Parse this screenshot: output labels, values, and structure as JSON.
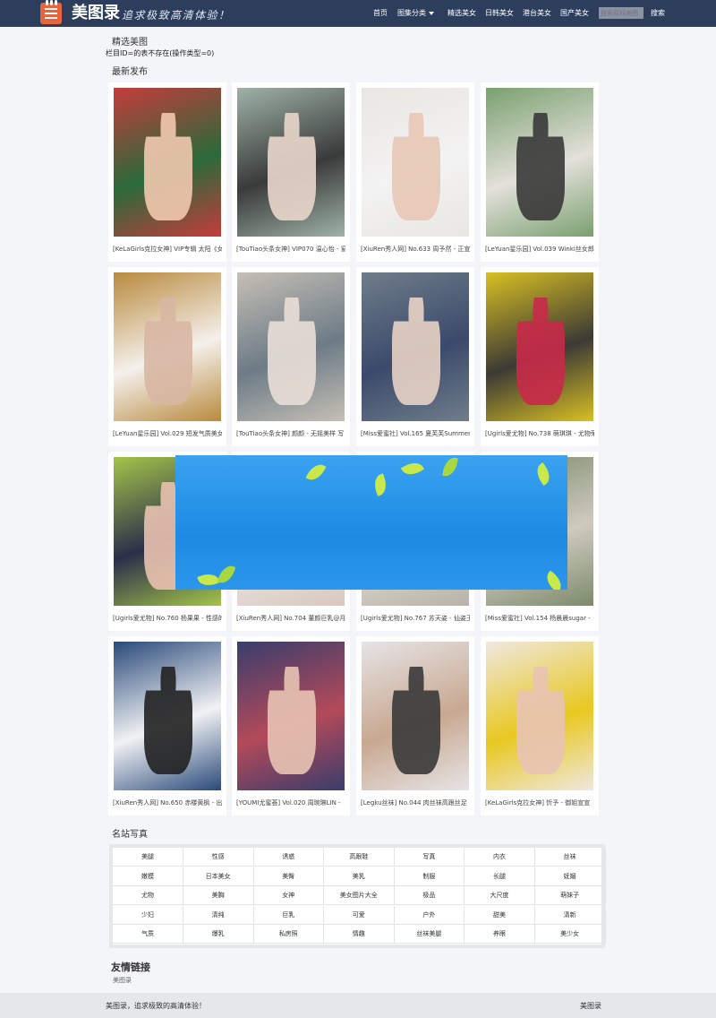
{
  "header": {
    "site_name": "美图录",
    "slogan": "追求极致高清体验！",
    "nav": [
      {
        "label": "首页"
      },
      {
        "label": "图集分类"
      },
      {
        "label": "精选美女"
      },
      {
        "label": "日韩美女"
      },
      {
        "label": "港台美女"
      },
      {
        "label": "国产美女"
      }
    ],
    "search_placeholder": "搜索原科美图",
    "search_button": "搜索",
    "bg_color": "#2c3e5b"
  },
  "section_featured": "精选美图",
  "error_text": "栏目ID=的表不存在(操作类型=0)",
  "section_latest": "最新发布",
  "gallery": [
    {
      "caption": "[KeLaGirls克拉女神] VIP专辑 太阳《女",
      "palette": [
        "#c43c3c",
        "#2a6a3a",
        "#f1c9b0"
      ]
    },
    {
      "caption": "[TouTiao头条女神] VIP070 温心怡 - 窗",
      "palette": [
        "#9fb2a8",
        "#3a3a3a",
        "#e9d7cb"
      ]
    },
    {
      "caption": "[XiuRen秀人网] No.633 周予然 - 正宣",
      "palette": [
        "#e9e6e2",
        "#f3f3f3",
        "#e8c8b6"
      ]
    },
    {
      "caption": "[LeYuan星乐园] Vol.039 Winki丝女郎",
      "palette": [
        "#7aa070",
        "#e3e0da",
        "#3a3a3a"
      ]
    },
    {
      "caption": "[LeYuan星乐园] Vol.029 短发气质美女",
      "palette": [
        "#b98a3e",
        "#f4f0ec",
        "#d9b7a4"
      ]
    },
    {
      "caption": "[TouTiao头条女神] 颜颜 - 无摇美样 写",
      "palette": [
        "#c5bfb6",
        "#6d7b86",
        "#e9dfd7"
      ]
    },
    {
      "caption": "[Miss爱蜜社] Vol.165 夏芙芙Summer",
      "palette": [
        "#6f7d8a",
        "#3b4a6b",
        "#e8d3c5"
      ]
    },
    {
      "caption": "[Ugirls爱尤物] No.738 萌琪琪 - 尤物荣",
      "palette": [
        "#d8c022",
        "#3c3a35",
        "#c82a4a"
      ]
    },
    {
      "caption": "[Ugirls爱尤物] No.760 杨果果 - 性感的",
      "palette": [
        "#a4c44a",
        "#2a2f4a",
        "#e9c2b0"
      ]
    },
    {
      "caption": "[XiuRen秀人网] No.704 董颜巨乳@月",
      "palette": [
        "#d9c6c0",
        "#ebe4e0",
        "#e6c8b8"
      ]
    },
    {
      "caption": "[Ugirls爱尤物] No.767 苏天姿 - 仙姿玉",
      "palette": [
        "#b8b2a8",
        "#dcd5cc",
        "#e2c8b8"
      ]
    },
    {
      "caption": "[Miss爱蜜社] Vol.154 杨晨晨sugar -",
      "palette": [
        "#7b8a6a",
        "#cfcac0",
        "#e4c7b6"
      ]
    },
    {
      "caption": "[XiuRen秀人网] No.650 赤楼黄枫 - 出",
      "palette": [
        "#2a4a7a",
        "#f2f2f4",
        "#222222"
      ]
    },
    {
      "caption": "[YOUMI尤蜜荟] Vol.020 周琬琳LIN -",
      "palette": [
        "#3a3d6b",
        "#b34a5a",
        "#e8c4b4"
      ]
    },
    {
      "caption": "[Legku丝袜] No.044 肉丝袜高跟丝足",
      "palette": [
        "#e6e4e6",
        "#c8a890",
        "#3a3a3a"
      ]
    },
    {
      "caption": "[KeLaGirls克拉女神] 忻予 - 御姐宣宣",
      "palette": [
        "#efe8e0",
        "#e8c820",
        "#e8c4b4"
      ]
    }
  ],
  "section_tags": "名站写真",
  "tags": [
    "美腿",
    "性感",
    "诱惑",
    "高跟鞋",
    "写真",
    "内衣",
    "丝袜",
    "嫩模",
    "日本美女",
    "美臀",
    "美乳",
    "制服",
    "长腿",
    "妩媚",
    "尤物",
    "美胸",
    "女神",
    "美女图片大全",
    "极品",
    "大尺度",
    "萌妹子",
    "少妇",
    "清纯",
    "巨乳",
    "可爱",
    "户外",
    "甜美",
    "清新",
    "气质",
    "爆乳",
    "私房照",
    "情趣",
    "丝袜美腿",
    "养眼",
    "美少女"
  ],
  "section_friends": "友情链接",
  "friend_link": "美图录",
  "footer": {
    "left": "美图录，追求极致的高清体验！",
    "right": "美图录"
  },
  "ad_color": "#2a92e8"
}
